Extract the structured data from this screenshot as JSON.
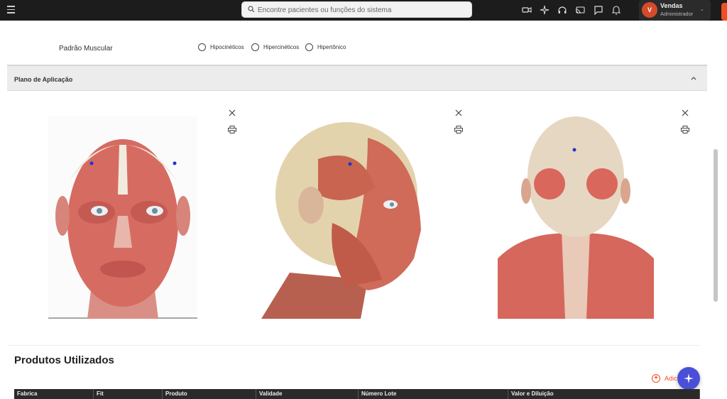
{
  "topbar": {
    "search_placeholder": "Encontre pacientes ou funções do sistema",
    "icons": [
      "video-icon",
      "sparkle-icon",
      "headset-icon",
      "cast-icon",
      "chat-icon",
      "bell-icon"
    ],
    "user": {
      "initial": "V",
      "name": "Vendas",
      "role": "Administrador"
    }
  },
  "form": {
    "padrao_label": "Padrão Muscular",
    "options": [
      "Hipocinéticos",
      "Hipercinéticos",
      "Hipertônico"
    ]
  },
  "section": {
    "title": "Plano de Aplicação"
  },
  "products": {
    "title": "Produtos Utilizados",
    "add_label": "Adic"
  },
  "table_headers": [
    "Fabrica",
    "Fit",
    "Produto",
    "Validade",
    "Número Lote",
    "Valor e Diluição"
  ],
  "colors": {
    "accent": "#f04e23",
    "fab": "#4a4fd8",
    "marker": "#2233cc",
    "topbar": "#1c1c1c"
  }
}
